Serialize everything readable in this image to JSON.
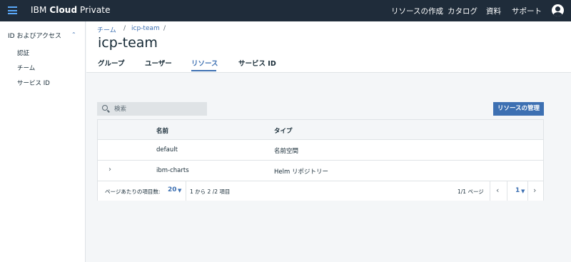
{
  "header": {
    "brand_prefix": "IBM ",
    "brand_bold": "Cloud",
    "brand_suffix": " Private",
    "nav": [
      "リソースの作成",
      "カタログ",
      "資料",
      "サポート"
    ],
    "accent_color": "#5aa9fa",
    "bg_color": "#1f2c3a"
  },
  "sidebar": {
    "group_label": "ID およびアクセス",
    "group_icon": "chevron-up-icon",
    "items": [
      "認証",
      "チーム",
      "サービス ID"
    ]
  },
  "breadcrumb": {
    "items": [
      "チーム",
      "icp-team"
    ],
    "separator": "/"
  },
  "page": {
    "title": "icp-team"
  },
  "tabs": [
    {
      "label": "グループ",
      "active": false
    },
    {
      "label": "ユーザー",
      "active": false
    },
    {
      "label": "リソース",
      "active": true
    },
    {
      "label": "サービス ID",
      "active": false
    }
  ],
  "search": {
    "placeholder": "検索",
    "value": ""
  },
  "manage_button": {
    "label": "リソースの管理",
    "color": "#3d70b2"
  },
  "table": {
    "columns": [
      "名前",
      "タイプ"
    ],
    "rows": [
      {
        "name": "default",
        "type": "名前空間",
        "expandable": false
      },
      {
        "name": "ibm-charts",
        "type": "Helm リポジトリー",
        "expandable": true
      }
    ]
  },
  "pagination": {
    "per_page_label": "ページあたりの項目数:",
    "per_page": "20",
    "range": "1 から 2 /2 項目",
    "page_info": "1/1 ページ",
    "current_page": "1"
  }
}
